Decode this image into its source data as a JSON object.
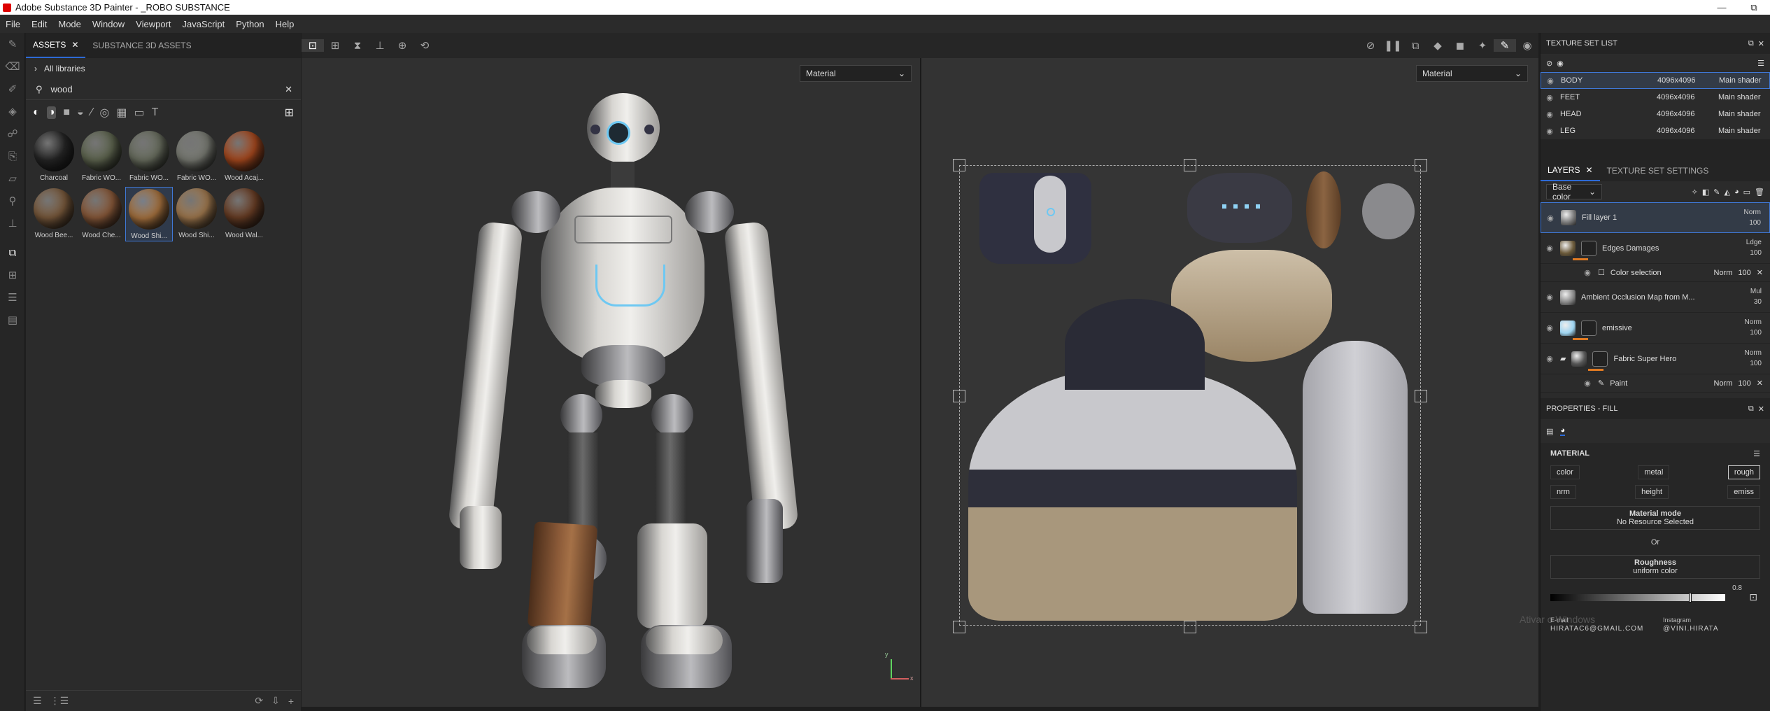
{
  "window": {
    "title": "Adobe Substance 3D Painter - _ROBO SUBSTANCE",
    "controls": [
      "—",
      "⧉"
    ]
  },
  "menu": [
    "File",
    "Edit",
    "Mode",
    "Window",
    "Viewport",
    "JavaScript",
    "Python",
    "Help"
  ],
  "assets": {
    "tabs": [
      "ASSETS",
      "SUBSTANCE 3D ASSETS"
    ],
    "library": "All libraries",
    "search_value": "wood",
    "items": [
      {
        "label": "Charcoal",
        "color": "#262626"
      },
      {
        "label": "Fabric WO...",
        "color": "#5f6650"
      },
      {
        "label": "Fabric WO...",
        "color": "#6a6f60"
      },
      {
        "label": "Fabric WO...",
        "color": "#7a7c74"
      },
      {
        "label": "Wood Acaj...",
        "color": "#a8491e"
      },
      {
        "label": "Wood Bee...",
        "color": "#7a5a3c"
      },
      {
        "label": "Wood Che...",
        "color": "#8a5a3a"
      },
      {
        "label": "Wood Shi...",
        "color": "#a8733f",
        "selected": true
      },
      {
        "label": "Wood Shi...",
        "color": "#a27a4f"
      },
      {
        "label": "Wood Wal...",
        "color": "#6a3e25"
      }
    ]
  },
  "viewport": {
    "left_mode": "Material",
    "right_mode": "Material",
    "axis_x": "x",
    "axis_y": "y"
  },
  "texture_sets": {
    "title": "TEXTURE SET LIST",
    "rows": [
      {
        "name": "BODY",
        "res": "4096x4096",
        "shader": "Main shader",
        "selected": true
      },
      {
        "name": "FEET",
        "res": "4096x4096",
        "shader": "Main shader"
      },
      {
        "name": "HEAD",
        "res": "4096x4096",
        "shader": "Main shader"
      },
      {
        "name": "LEG",
        "res": "4096x4096",
        "shader": "Main shader"
      }
    ]
  },
  "layers": {
    "tabs": [
      "LAYERS",
      "TEXTURE SET SETTINGS"
    ],
    "channel": "Base color",
    "items": [
      {
        "type": "layer",
        "name": "Fill layer 1",
        "blend": "Norm",
        "opacity": "100",
        "selected": true,
        "thumb": "#777"
      },
      {
        "type": "layer",
        "name": "Edges Damages",
        "blend": "Ldge",
        "opacity": "100",
        "thumb": "#6b5a3a",
        "mask": true
      },
      {
        "type": "sub",
        "name": "Color selection",
        "blend": "Norm",
        "opacity": "100"
      },
      {
        "type": "layer",
        "name": "Ambient Occlusion Map from M...",
        "blend": "Mul",
        "opacity": "30",
        "thumb": "#888"
      },
      {
        "type": "layer",
        "name": "emissive",
        "blend": "Norm",
        "opacity": "100",
        "thumb": "#9ed4f0",
        "mask": true
      },
      {
        "type": "layer",
        "name": "Fabric Super Hero",
        "blend": "Norm",
        "opacity": "100",
        "thumb": "#555",
        "mask": true,
        "folder": true
      },
      {
        "type": "sub",
        "name": "Paint",
        "blend": "Norm",
        "opacity": "100"
      }
    ]
  },
  "properties": {
    "title": "PROPERTIES - FILL",
    "section": "MATERIAL",
    "channels_row1": [
      "color",
      "metal",
      "rough"
    ],
    "channels_row2": [
      "nrm",
      "height",
      "emiss"
    ],
    "material_mode_label": "Material mode",
    "material_mode_value": "No Resource Selected",
    "or": "Or",
    "roughness_label": "Roughness",
    "roughness_value": "uniform color",
    "roughness_number": "0.8",
    "roughness_fraction": 0.8
  },
  "watermark": {
    "email_label": "E-mail",
    "email": "HIRATAC6@GMAIL.COM",
    "insta_label": "Instagram",
    "insta": "@VINI.HIRATA",
    "activate": "Ativar o Windows"
  }
}
